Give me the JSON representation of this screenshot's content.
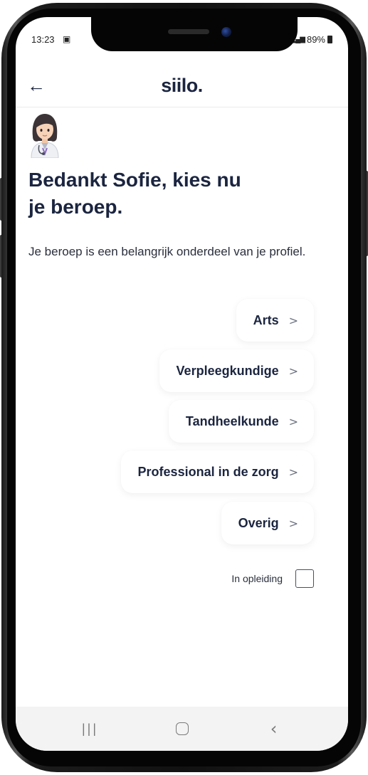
{
  "status_bar": {
    "time": "13:23",
    "battery": "89%"
  },
  "header": {
    "back_icon": "arrow-left-icon",
    "logo": "siilo."
  },
  "avatar": {
    "icon": "woman-health-worker-emoji"
  },
  "heading": {
    "line1": "Bedankt Sofie, kies nu",
    "line2": "je beroep."
  },
  "subtitle": "Je beroep is een belangrijk onderdeel van je profiel.",
  "options": [
    {
      "label": "Arts",
      "chevron": ">"
    },
    {
      "label": "Verpleegkundige",
      "chevron": ">"
    },
    {
      "label": "Tandheelkunde",
      "chevron": ">"
    },
    {
      "label": "Professional in de zorg",
      "chevron": ">"
    },
    {
      "label": "Overig",
      "chevron": ">"
    }
  ],
  "training": {
    "label": "In opleiding",
    "checked": false
  },
  "nav_bar": {
    "recent_icon": "recent-apps-icon",
    "home_icon": "home-icon",
    "back_icon": "back-icon"
  },
  "colors": {
    "text_primary": "#1b2540",
    "nav_bg": "#f3f3f3"
  }
}
